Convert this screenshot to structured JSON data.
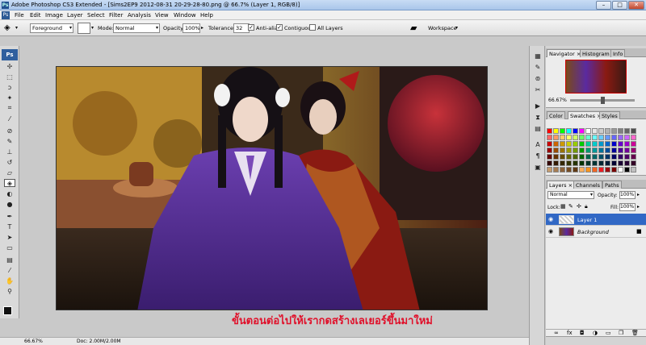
{
  "window": {
    "title": "Adobe Photoshop CS3 Extended - [Sims2EP9 2012-08-31 20-29-28-80.png @ 66.7% (Layer 1, RGB/8)]",
    "app_badge": "Ps",
    "minimize": "–",
    "maximize": "□",
    "close": "✕"
  },
  "menu": [
    "File",
    "Edit",
    "Image",
    "Layer",
    "Select",
    "Filter",
    "Analysis",
    "View",
    "Window",
    "Help"
  ],
  "options_bar": {
    "fill_source": "Foreground",
    "mode_label": "Mode:",
    "mode_value": "Normal",
    "opacity_label": "Opacity:",
    "opacity_value": "100%",
    "tolerance_label": "Tolerance:",
    "tolerance_value": "32",
    "anti_alias": "Anti-alias",
    "contiguous": "Contiguous",
    "all_layers": "All Layers",
    "workspace": "Workspace"
  },
  "toolbox": {
    "badge": "Ps"
  },
  "caption": "ขั้นตอนต่อไปให้เรากดสร้างเลเยอร์ขึ้นมาใหม่",
  "status": {
    "zoom": "66.67%",
    "doc": "Doc: 2.00M/2.00M"
  },
  "navigator": {
    "tabs": [
      "Navigator",
      "Histogram",
      "Info"
    ],
    "zoom": "66.67%"
  },
  "swatches": {
    "tabs": [
      "Color",
      "Swatches",
      "Styles"
    ]
  },
  "layers": {
    "tabs": [
      "Layers",
      "Channels",
      "Paths"
    ],
    "blend": "Normal",
    "opacity_label": "Opacity:",
    "opacity_value": "100%",
    "lock_label": "Lock:",
    "fill_label": "Fill:",
    "fill_value": "100%",
    "items": [
      {
        "name": "Layer 1",
        "selected": true
      },
      {
        "name": "Background",
        "selected": false
      }
    ]
  },
  "colors": {
    "accent_blue": "#3168c5",
    "caption_red": "#e0102a"
  }
}
